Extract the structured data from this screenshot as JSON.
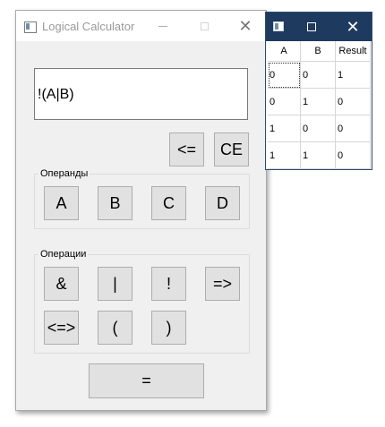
{
  "calculator": {
    "title": "Logical Calculator",
    "display_value": "!(A|B)",
    "backspace_label": "<=",
    "clear_label": "CE",
    "operands": {
      "label": "Операнды",
      "buttons": [
        "A",
        "B",
        "C",
        "D"
      ]
    },
    "operations": {
      "label": "Операции",
      "buttons": [
        "&",
        "|",
        "!",
        "=>",
        "<=>",
        "(",
        ")"
      ]
    },
    "equals_label": "="
  },
  "truth_table": {
    "headers": [
      "A",
      "B",
      "Result"
    ],
    "rows": [
      [
        "0",
        "0",
        "1"
      ],
      [
        "0",
        "1",
        "0"
      ],
      [
        "1",
        "0",
        "0"
      ],
      [
        "1",
        "1",
        "0"
      ]
    ]
  },
  "icons": {
    "close": "close-icon",
    "minimize": "minimize-icon",
    "maximize": "maximize-icon",
    "app": "app-icon"
  },
  "colors": {
    "table_titlebar": "#1f3a5f",
    "window_bg": "#f0f0f0",
    "button_bg": "#e1e1e1"
  }
}
